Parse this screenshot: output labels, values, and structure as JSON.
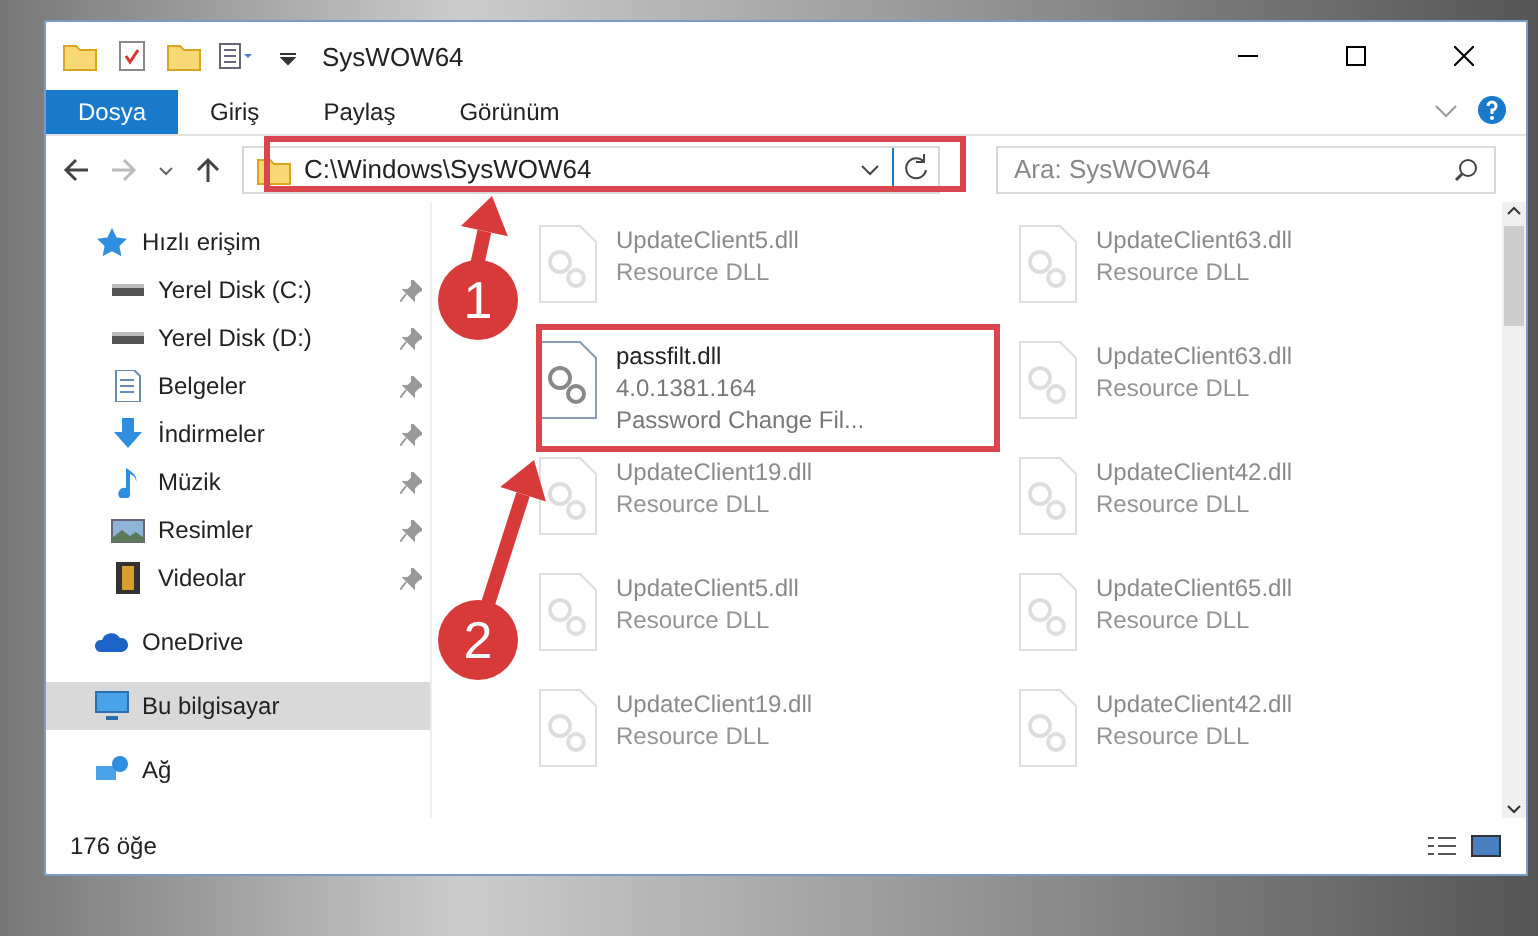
{
  "window": {
    "title": "SysWOW64"
  },
  "ribbon_tabs": [
    {
      "label": "Dosya",
      "selected": true
    },
    {
      "label": "Giriş",
      "selected": false
    },
    {
      "label": "Paylaş",
      "selected": false
    },
    {
      "label": "Görünüm",
      "selected": false
    }
  ],
  "address": {
    "value": "C:\\Windows\\SysWOW64"
  },
  "search": {
    "placeholder": "Ara: SysWOW64"
  },
  "sidebar": {
    "items": [
      {
        "label": "Hızlı erişim",
        "kind": "star",
        "selected": false,
        "children": [
          {
            "label": "Yerel Disk (C:)",
            "kind": "drive",
            "pinned": true,
            "selected": false
          },
          {
            "label": "Yerel Disk (D:)",
            "kind": "drive",
            "pinned": true,
            "selected": false
          },
          {
            "label": "Belgeler",
            "kind": "document",
            "pinned": true,
            "selected": false
          },
          {
            "label": "İndirmeler",
            "kind": "download",
            "pinned": true,
            "selected": false
          },
          {
            "label": "Müzik",
            "kind": "music",
            "pinned": true,
            "selected": false
          },
          {
            "label": "Resimler",
            "kind": "picture",
            "pinned": true,
            "selected": false
          },
          {
            "label": "Videolar",
            "kind": "video",
            "pinned": true,
            "selected": false
          }
        ]
      },
      {
        "label": "OneDrive",
        "kind": "cloud",
        "selected": false
      },
      {
        "label": "Bu bilgisayar",
        "kind": "computer",
        "selected": true
      },
      {
        "label": "Ağ",
        "kind": "network",
        "selected": false
      }
    ]
  },
  "files": [
    {
      "name": "UpdateClient5.dll",
      "detail": "Resource DLL",
      "dimmed": true,
      "highlighted": false
    },
    {
      "name": "UpdateClient63.dll",
      "detail": "Resource DLL",
      "dimmed": true,
      "highlighted": false
    },
    {
      "name": "passfilt.dll",
      "version": "4.0.1381.164",
      "detail": "Password Change Fil...",
      "dimmed": false,
      "highlighted": true
    },
    {
      "name": "UpdateClient63.dll",
      "detail": "Resource DLL",
      "dimmed": true,
      "highlighted": false
    },
    {
      "name": "UpdateClient19.dll",
      "detail": "Resource DLL",
      "dimmed": true,
      "highlighted": false
    },
    {
      "name": "UpdateClient42.dll",
      "detail": "Resource DLL",
      "dimmed": true,
      "highlighted": false
    },
    {
      "name": "UpdateClient5.dll",
      "detail": "Resource DLL",
      "dimmed": true,
      "highlighted": false
    },
    {
      "name": "UpdateClient65.dll",
      "detail": "Resource DLL",
      "dimmed": true,
      "highlighted": false
    },
    {
      "name": "UpdateClient19.dll",
      "detail": "Resource DLL",
      "dimmed": true,
      "highlighted": false
    },
    {
      "name": "UpdateClient42.dll",
      "detail": "Resource DLL",
      "dimmed": true,
      "highlighted": false
    }
  ],
  "status_bar": {
    "count": "176 öğe"
  },
  "annotations": [
    {
      "label": "1"
    },
    {
      "label": "2"
    }
  ]
}
